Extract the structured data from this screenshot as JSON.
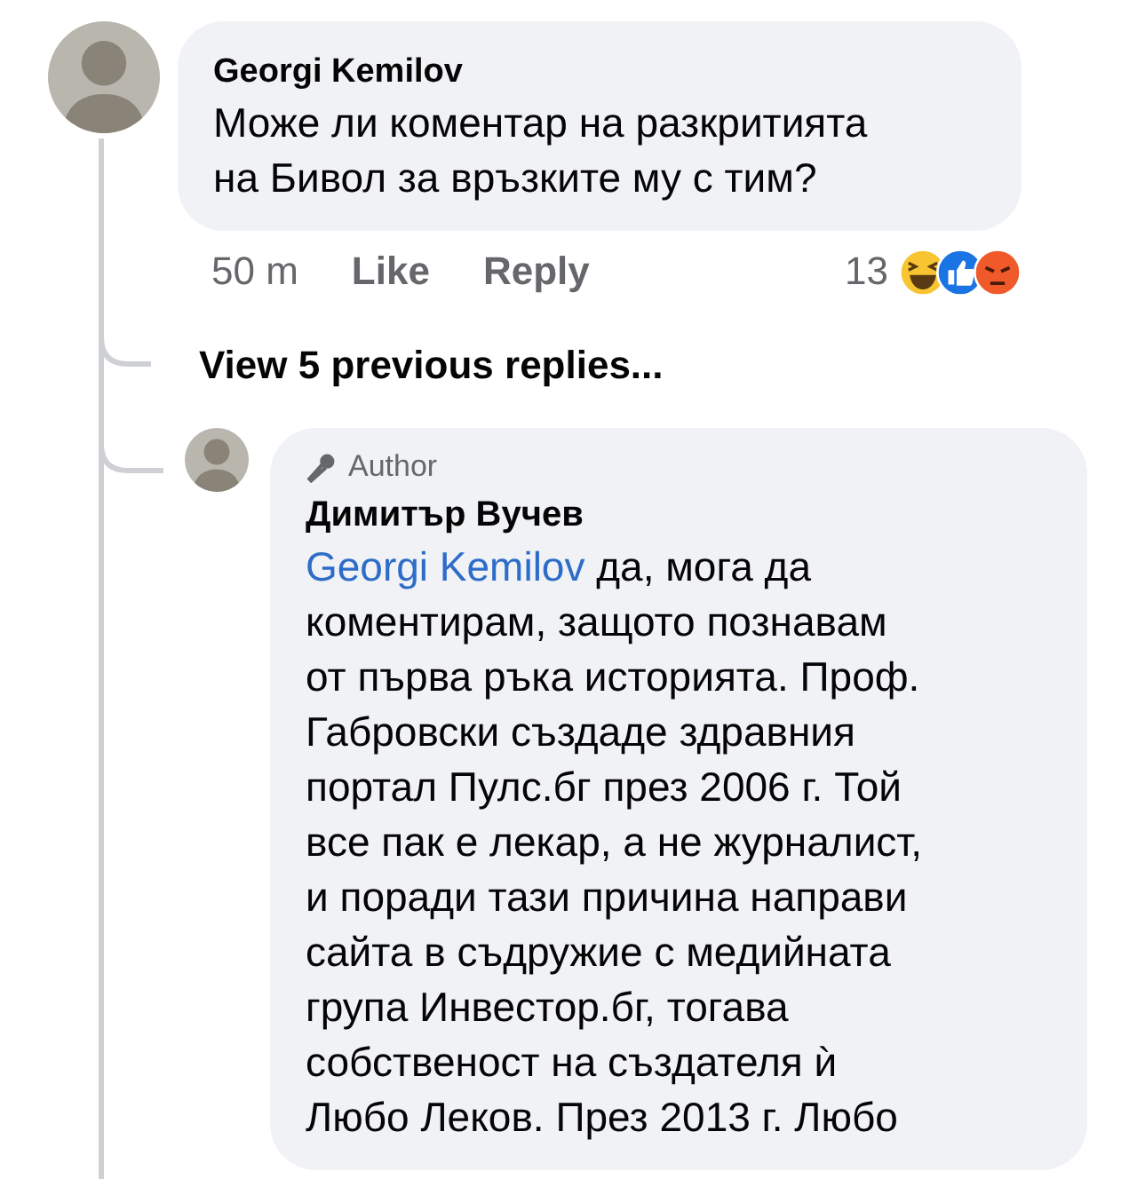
{
  "comment": {
    "author": "Georgi Kemilov",
    "lines": [
      "Може ли коментар на разкритията",
      "на Бивол за връзките му с тим?"
    ],
    "time": "50 m",
    "actions": [
      "Like",
      "Reply"
    ],
    "reaction_count": "13"
  },
  "view_replies": "View 5 previous replies...",
  "reply": {
    "badge": "Author",
    "author": "Димитър Вучев",
    "mention": "Georgi Kemilov",
    "lines": [
      "да, мога да",
      "коментирам, защото познавам",
      "от първа ръка историята. Проф.",
      "Габровски създаде здравния",
      "портал Пулс.бг през 2006 г. Той",
      "все пак е лекар, а не журналист,",
      "и поради тази причина направи",
      "сайта в съдружие с медийната",
      "група Инвестор.бг, тогава",
      "собственост на създателя ѝ",
      "Любо Леков. През 2013 г. Любо"
    ]
  }
}
